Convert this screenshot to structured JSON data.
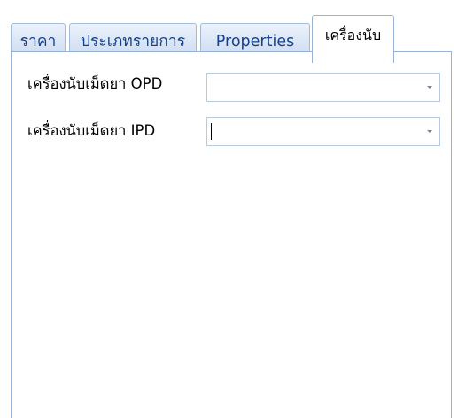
{
  "tabs": [
    {
      "label": "ราคา",
      "active": false
    },
    {
      "label": "ประเภทรายการ",
      "active": false
    },
    {
      "label": "Properties",
      "active": false
    },
    {
      "label": "เครื่องนับ",
      "active": true
    }
  ],
  "form": {
    "opd": {
      "label": "เครื่องนับเม็ดยา OPD",
      "value": ""
    },
    "ipd": {
      "label": "เครื่องนับเม็ดยา IPD",
      "value": ""
    }
  },
  "colors": {
    "tab_text": "#15428b",
    "tab_border": "#a4bbd7",
    "panel_border": "#99b3d5",
    "dropdown_arrow": "#6d87ad"
  },
  "icons": {
    "dropdown": "chevron-down-icon"
  }
}
